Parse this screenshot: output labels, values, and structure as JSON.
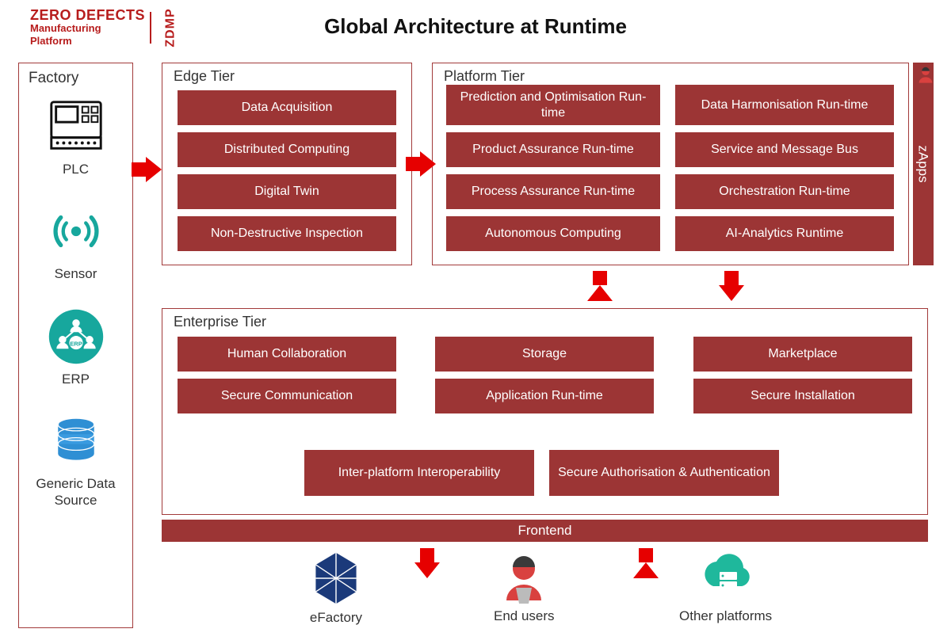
{
  "logo": {
    "main": "ZERO DEFECTS",
    "sub1": "Manufacturing",
    "sub2": "Platform",
    "short": "ZDMP"
  },
  "title": "Global Architecture at Runtime",
  "factory": {
    "title": "Factory",
    "items": [
      {
        "label": "PLC"
      },
      {
        "label": "Sensor"
      },
      {
        "label": "ERP"
      },
      {
        "label": "Generic Data Source"
      }
    ]
  },
  "edge": {
    "title": "Edge Tier",
    "blocks": [
      "Data Acquisition",
      "Distributed Computing",
      "Digital Twin",
      "Non-Destructive Inspection"
    ]
  },
  "platform": {
    "title": "Platform Tier",
    "left": [
      "Prediction and Optimisation Run-time",
      "Product Assurance Run-time",
      "Process Assurance Run-time",
      "Autonomous Computing"
    ],
    "right": [
      "Data Harmonisation Run-time",
      "Service and Message Bus",
      "Orchestration Run-time",
      "AI-Analytics Runtime"
    ]
  },
  "zapps": "zApps",
  "enterprise": {
    "title": "Enterprise Tier",
    "row1": [
      "Human Collaboration",
      "Storage",
      "Marketplace"
    ],
    "row2": [
      "Secure Communication",
      "Application Run-time",
      "Secure Installation"
    ],
    "row3": [
      "Inter-platform Interoperability",
      "Secure Authorisation & Authentication"
    ]
  },
  "frontend": "Frontend",
  "bottom": [
    {
      "label": "eFactory"
    },
    {
      "label": "End users"
    },
    {
      "label": "Other platforms"
    }
  ],
  "user_icon_label": "user"
}
